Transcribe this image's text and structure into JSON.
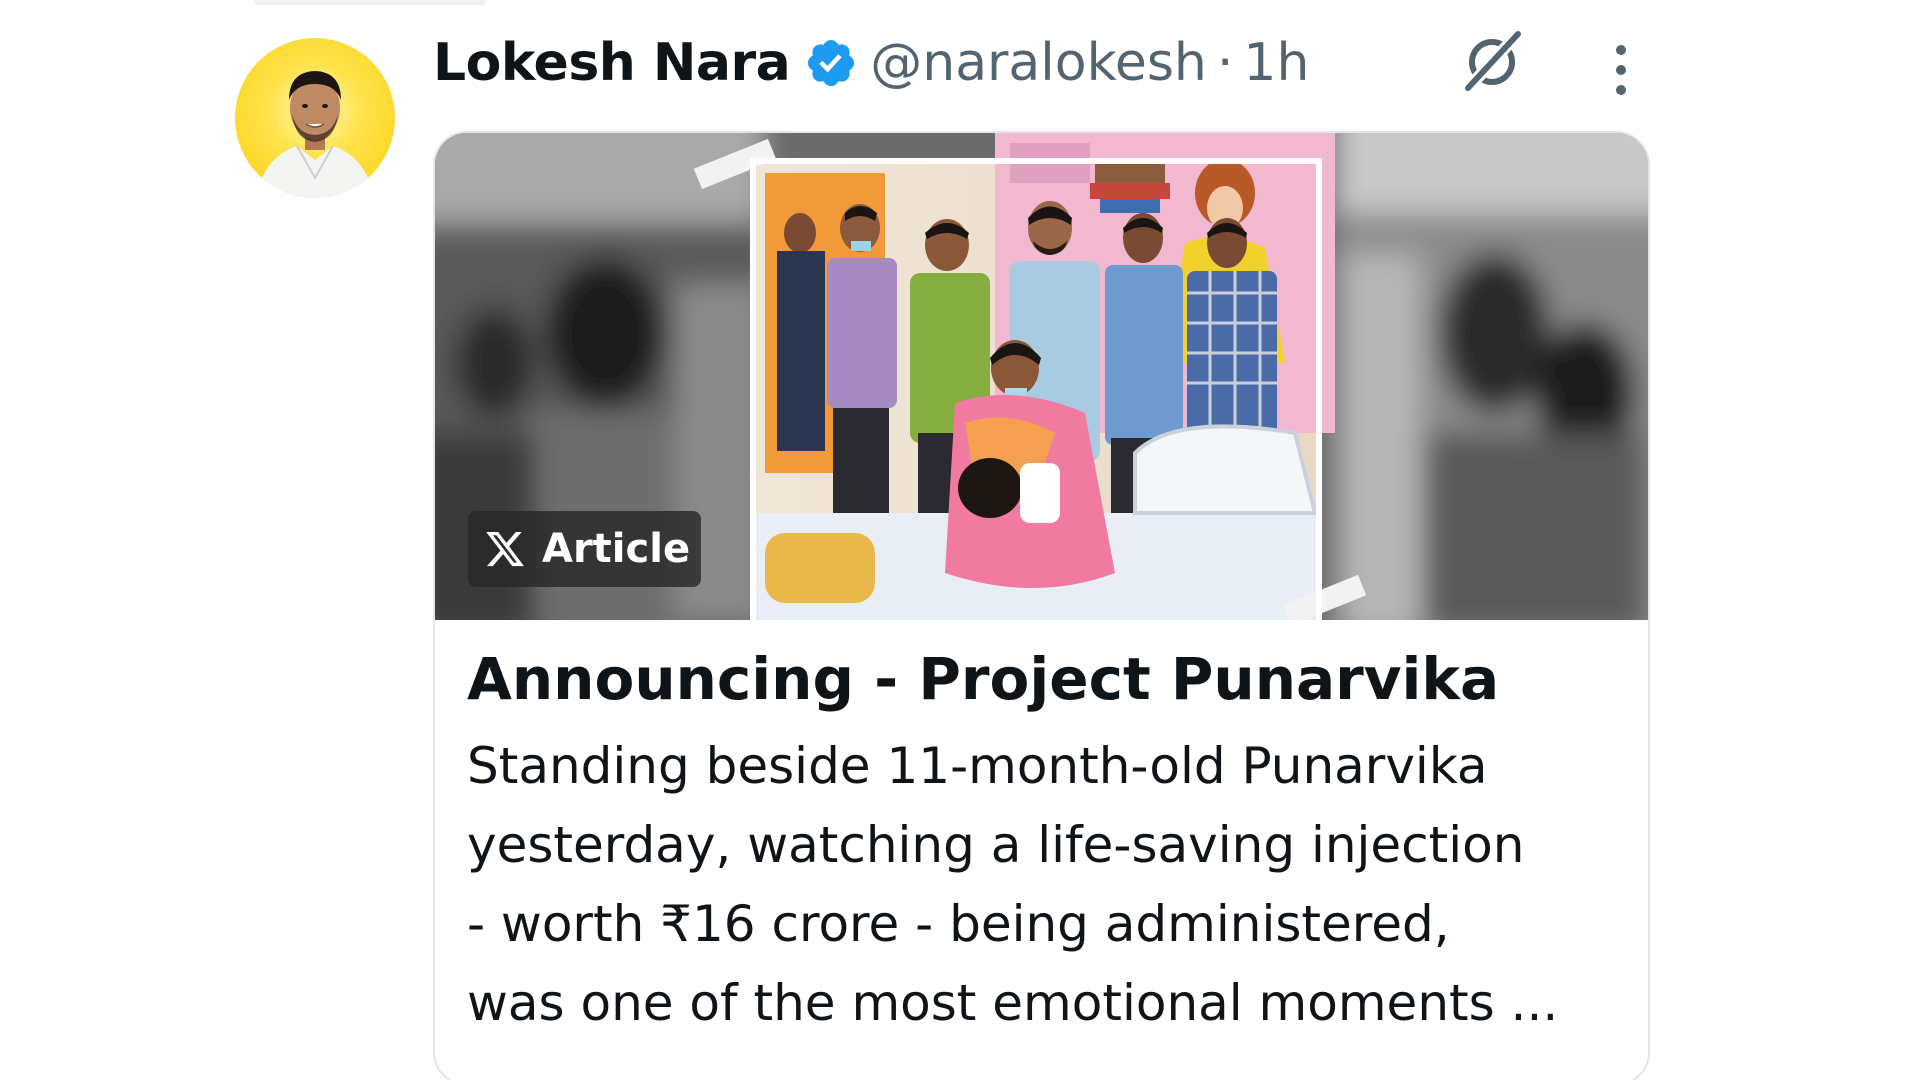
{
  "tweet": {
    "display_name": "Lokesh Nara",
    "handle": "@naralokesh",
    "separator": "·",
    "time": "1h",
    "verified": true,
    "avatar_bg": "#f7cf10"
  },
  "icons": {
    "verified": "verified-badge-icon",
    "grok": "grok-icon",
    "more": "more-vertical-icon",
    "x_logo": "x-logo-icon"
  },
  "colors": {
    "verified_blue": "#1d9bf0",
    "text_primary": "#0f1419",
    "text_secondary": "#536471",
    "card_border": "#e1e6ea"
  },
  "article": {
    "badge_label": "Article",
    "title": "Announcing - Project Punarvika",
    "excerpt_lines": [
      "Standing beside 11-month-old Punarvika",
      "yesterday, watching a life-saving injection",
      "- worth ₹16 crore - being administered,",
      "was one of the most emotional moments ..."
    ]
  }
}
